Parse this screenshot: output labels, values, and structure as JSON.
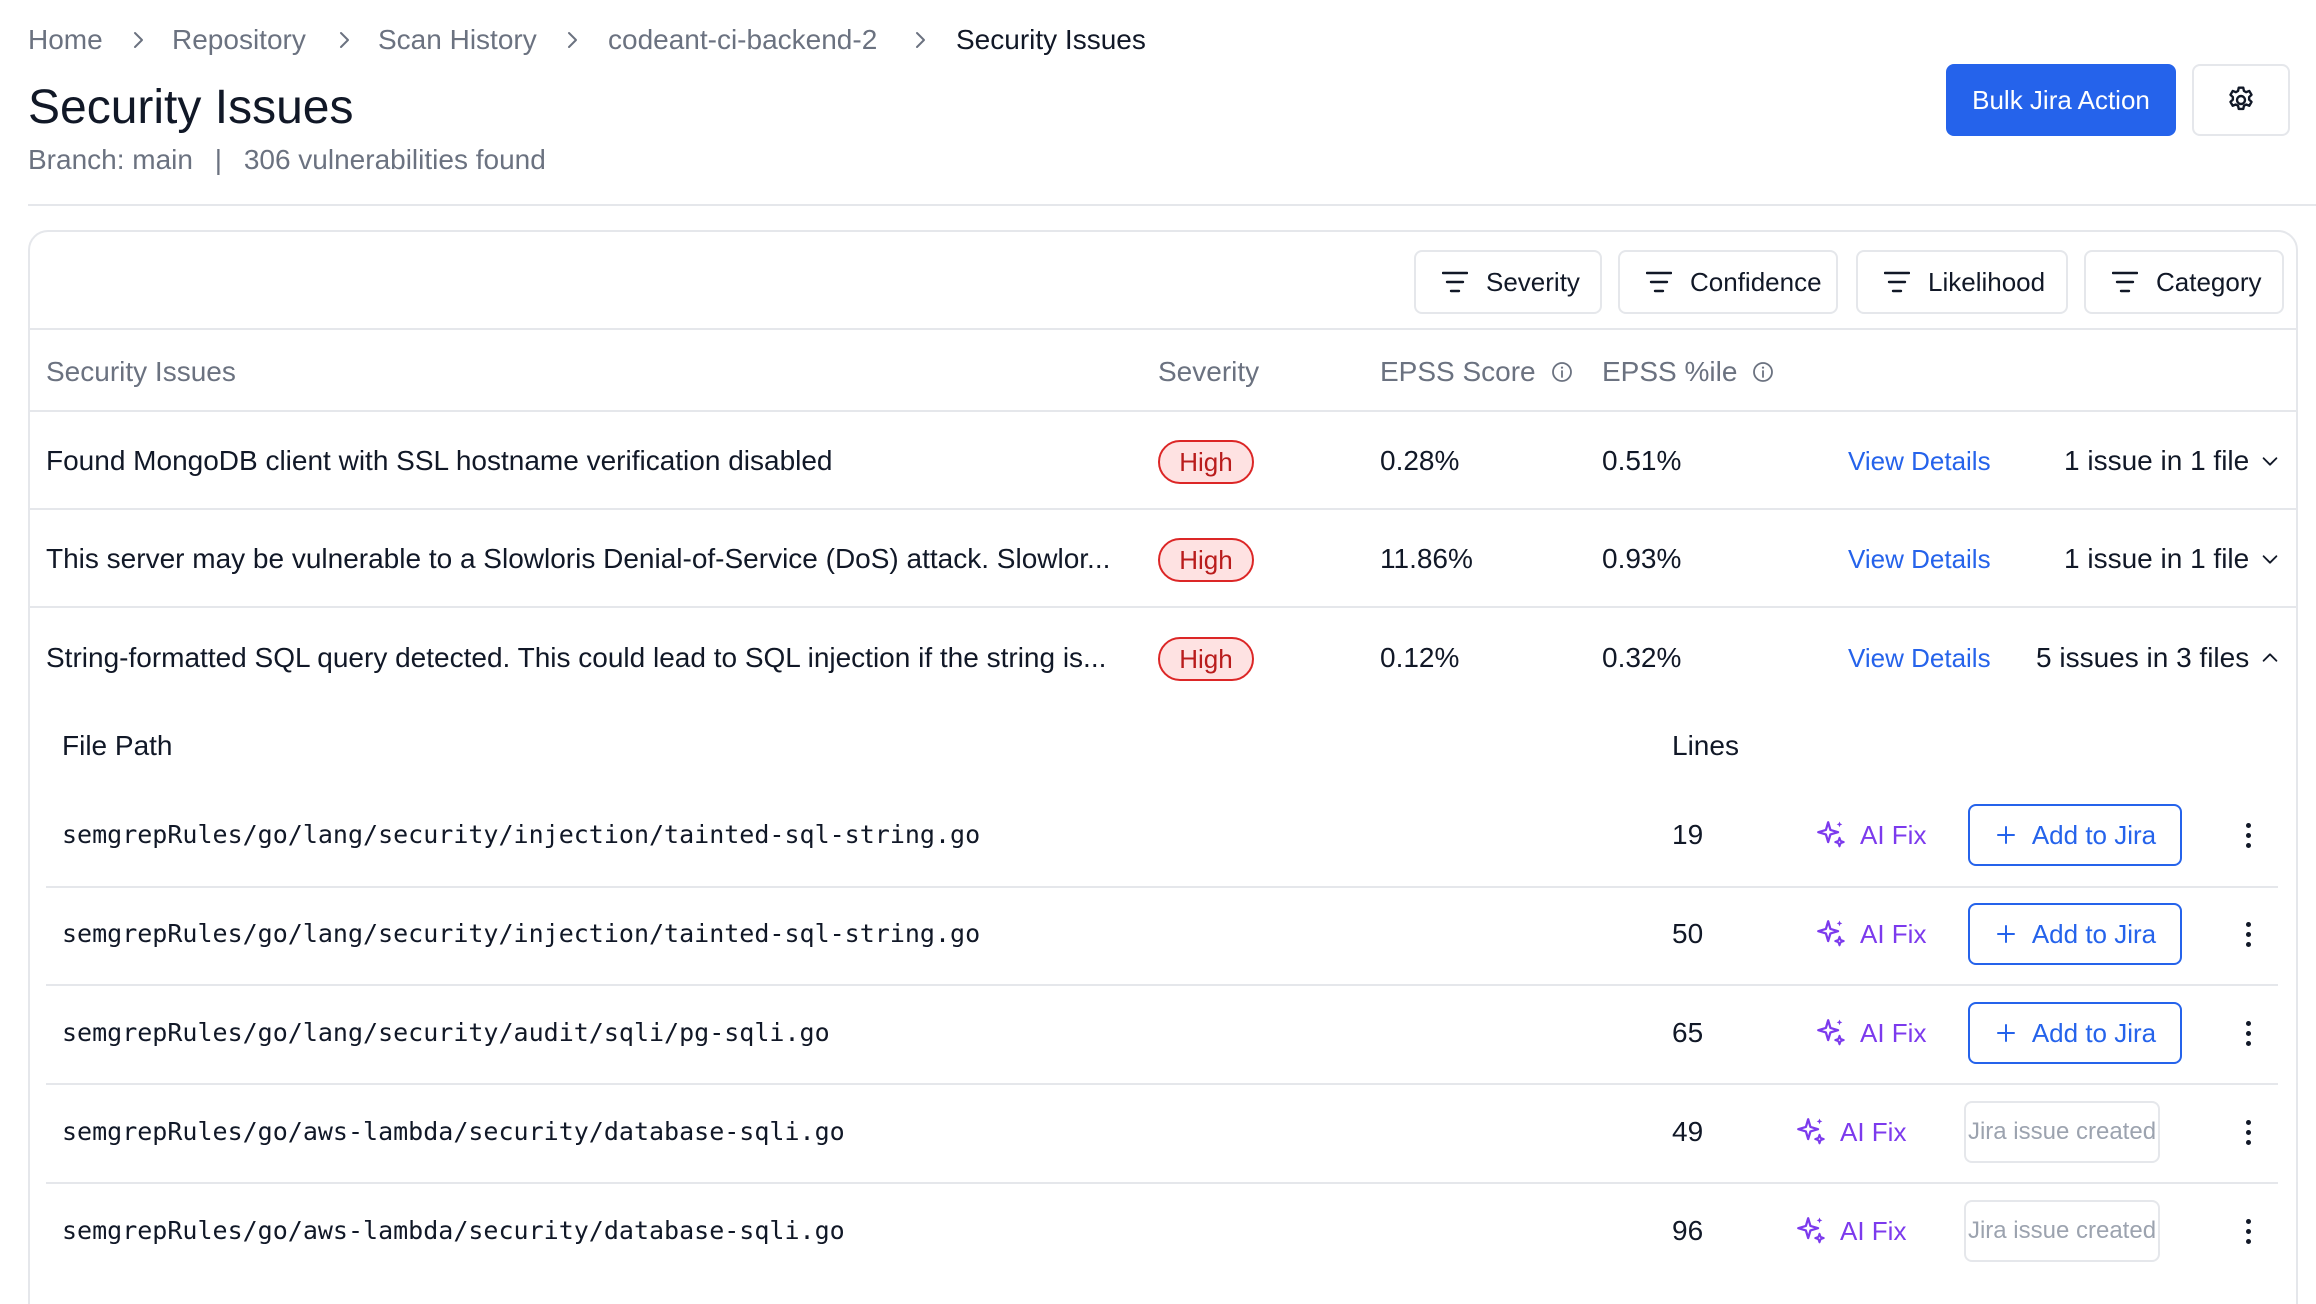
{
  "breadcrumb": {
    "items": [
      "Home",
      "Repository",
      "Scan History",
      "codeant-ci-backend-2",
      "Security Issues"
    ]
  },
  "header": {
    "title": "Security Issues",
    "branch_label": "Branch: main",
    "separator": "|",
    "vuln_count": "306 vulnerabilities found",
    "bulk_action_label": "Bulk Jira Action",
    "settings_icon": "gear-icon"
  },
  "filters": [
    {
      "label": "Severity",
      "icon": "filter-icon"
    },
    {
      "label": "Confidence",
      "icon": "filter-icon"
    },
    {
      "label": "Likelihood",
      "icon": "filter-icon"
    },
    {
      "label": "Category",
      "icon": "filter-icon"
    }
  ],
  "table": {
    "columns": {
      "issue": "Security Issues",
      "severity": "Severity",
      "epss_score": "EPSS Score",
      "epss_pct": "EPSS %ile"
    },
    "rows": [
      {
        "title": "Found MongoDB client with SSL hostname verification disabled",
        "severity": "High",
        "epss_score": "0.28%",
        "epss_pct": "0.51%",
        "details_label": "View Details",
        "count": "1 issue in 1 file",
        "expanded": false
      },
      {
        "title": "This server may be vulnerable to a Slowloris Denial-of-Service (DoS) attack. Slowlor...",
        "severity": "High",
        "epss_score": "11.86%",
        "epss_pct": "0.93%",
        "details_label": "View Details",
        "count": "1 issue in 1 file",
        "expanded": false
      },
      {
        "title": "String-formatted SQL query detected. This could lead to SQL injection if the string is...",
        "severity": "High",
        "epss_score": "0.12%",
        "epss_pct": "0.32%",
        "details_label": "View Details",
        "count": "5 issues in 3 files",
        "expanded": true
      }
    ]
  },
  "files": {
    "columns": {
      "path": "File Path",
      "lines": "Lines"
    },
    "ai_fix_label": "AI Fix",
    "add_jira_label": "Add to Jira",
    "jira_created_label": "Jira issue created",
    "rows": [
      {
        "path": "semgrepRules/go/lang/security/injection/tainted-sql-string.go",
        "line": "19",
        "jira_created": false
      },
      {
        "path": "semgrepRules/go/lang/security/injection/tainted-sql-string.go",
        "line": "50",
        "jira_created": false
      },
      {
        "path": "semgrepRules/go/lang/security/audit/sqli/pg-sqli.go",
        "line": "65",
        "jira_created": false
      },
      {
        "path": "semgrepRules/go/aws-lambda/security/database-sqli.go",
        "line": "49",
        "jira_created": true
      },
      {
        "path": "semgrepRules/go/aws-lambda/security/database-sqli.go",
        "line": "96",
        "jira_created": true
      }
    ]
  },
  "colors": {
    "primary": "#2563eb",
    "danger": "#dc2626",
    "ai": "#7c3aed",
    "muted": "#6b7280",
    "border": "#e5e7eb"
  }
}
